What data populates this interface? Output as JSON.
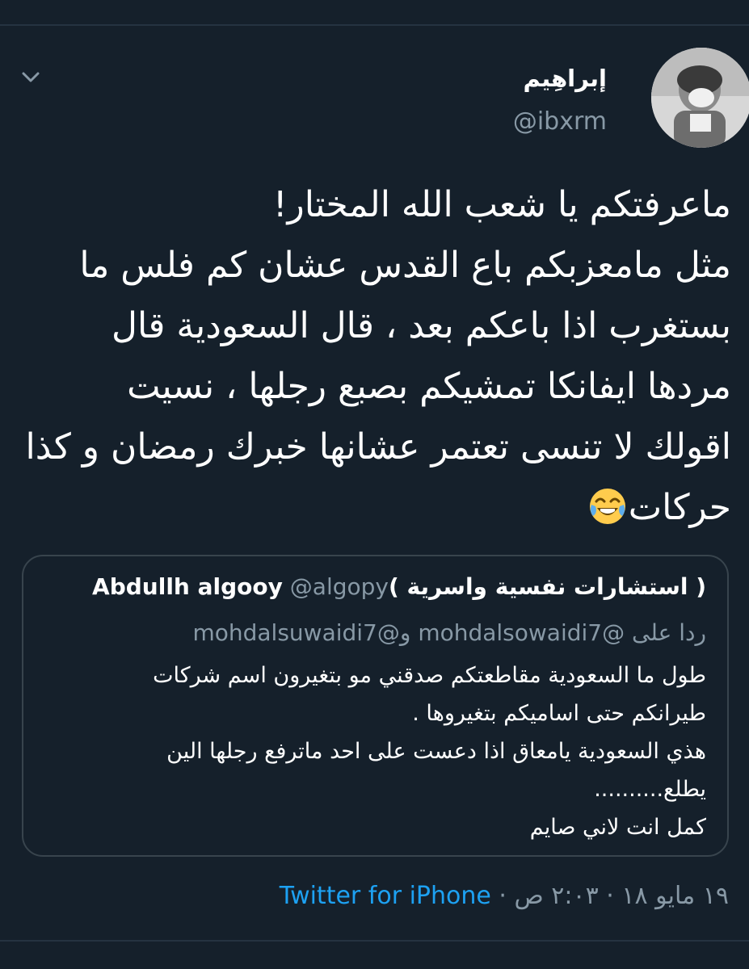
{
  "tweet": {
    "display_name": "إبراهِيم",
    "handle": "@ibxrm",
    "text_lines": [
      "ماعرفتكم يا شعب الله المختار!",
      "مثل مامعزبكم باع القدس عشان كم فلس ما",
      "بستغرب اذا باعكم بعد ، قال السعودية قال",
      "مردها ايفانكا تمشيكم بصبع رجلها ، نسيت",
      "اقولك لا تنسى تعتمر عشانها خبرك رمضان و كذا",
      "حركات"
    ],
    "emoji": "face-with-tears-of-joy"
  },
  "quote": {
    "author_name": "( استشارات نفسية واسرية )Abdullh algooy",
    "author_handle": "@algopy",
    "reply_label": "ردا على",
    "reply_handle_1": "@mohdalsowaidi7",
    "reply_and": "و",
    "reply_handle_2": "@mohdalsuwaidi7",
    "body_lines": [
      "طول ما السعودية مقاطعتكم صدقني مو بتغيرون اسم شركات",
      "طيرانكم حتى اساميكم بتغيروها .",
      "هذي السعودية يامعاق اذا دعست على احد ماترفع رجلها الين",
      "يطلع..........",
      "كمل انت لاني صايم"
    ]
  },
  "meta": {
    "time": "٢:٠٣ ص",
    "date": "١٩ مايو ١٨",
    "separator": "·",
    "source": "Twitter for iPhone"
  },
  "icons": {
    "menu": "chevron-down-icon",
    "avatar": "avatar"
  },
  "colors": {
    "background": "#15202b",
    "secondary_text": "#8899a6",
    "link": "#1da1f2",
    "border": "#38444d"
  }
}
